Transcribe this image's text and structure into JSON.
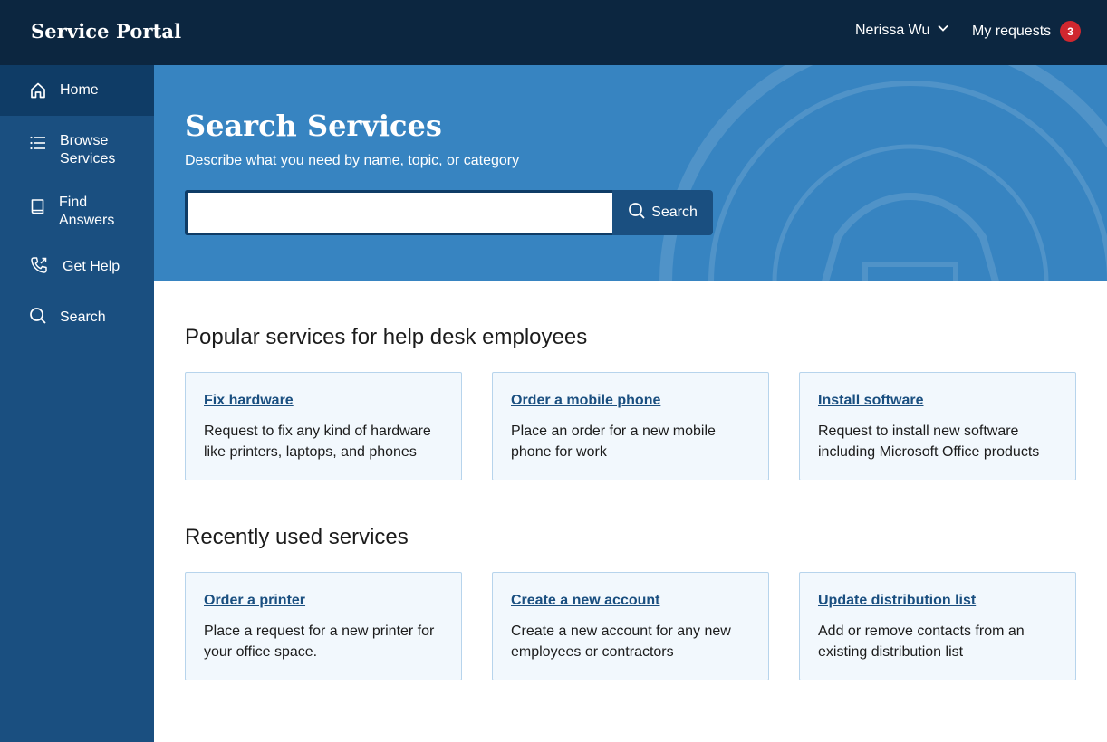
{
  "header": {
    "brand": "Service Portal",
    "user_name": "Nerissa Wu",
    "requests_label": "My requests",
    "requests_count": "3"
  },
  "sidebar": {
    "items": [
      {
        "label": "Home",
        "icon": "home-icon",
        "active": true
      },
      {
        "label": "Browse Services",
        "icon": "list-icon"
      },
      {
        "label": "Find Answers",
        "icon": "book-icon"
      },
      {
        "label": "Get Help",
        "icon": "phone-icon"
      },
      {
        "label": "Search",
        "icon": "search-icon"
      }
    ]
  },
  "hero": {
    "title": "Search Services",
    "subtitle": "Describe what you need by name, topic, or category",
    "search_value": "",
    "search_button": "Search"
  },
  "popular": {
    "title": "Popular services for help desk employees",
    "cards": [
      {
        "title": "Fix hardware",
        "desc": "Request to fix any kind of hardware like printers, laptops, and phones"
      },
      {
        "title": "Order a mobile phone",
        "desc": "Place an order for a new mobile phone for work"
      },
      {
        "title": "Install software",
        "desc": "Request to install new software including Microsoft Office products"
      }
    ]
  },
  "recent": {
    "title": "Recently used services",
    "cards": [
      {
        "title": "Order a printer",
        "desc": "Place a request for a new printer for your office space."
      },
      {
        "title": "Create a new account",
        "desc": "Create a new account for any new employees or contractors"
      },
      {
        "title": "Update distribution list",
        "desc": "Add or remove contacts from an existing distribution list"
      }
    ]
  },
  "colors": {
    "topbar": "#0c2640",
    "sidebar": "#1a4f80",
    "sidebar_active": "#0f3c66",
    "hero": "#3784c1",
    "badge": "#d0272f",
    "link": "#1a4f80"
  }
}
